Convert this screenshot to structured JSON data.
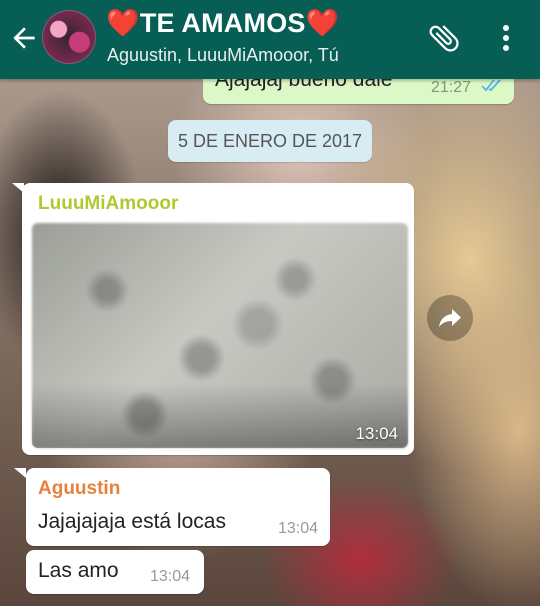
{
  "header": {
    "title": "❤️TE AMAMOS❤️",
    "subtitle": "Aguustin, LuuuMiAmooor, Tú",
    "colors": {
      "bar": "#075e54"
    },
    "icons": [
      "back-arrow-icon",
      "group-avatar",
      "attach-clip-icon",
      "more-vert-icon"
    ]
  },
  "messages": {
    "top_outgoing": {
      "text": "Ajajajaj bueno dale",
      "time": "21:27",
      "status": "read-double-check"
    },
    "date_divider": "5 DE ENERO DE 2017",
    "image_message": {
      "sender": "LuuuMiAmooor",
      "time": "13:04",
      "sender_color": "#b3c732"
    },
    "text_message_1": {
      "sender": "Aguustin",
      "text": "Jajajajaja está locas",
      "time": "13:04",
      "sender_color": "#e8813b"
    },
    "text_message_2": {
      "text": "Las amo",
      "time": "13:04"
    }
  }
}
